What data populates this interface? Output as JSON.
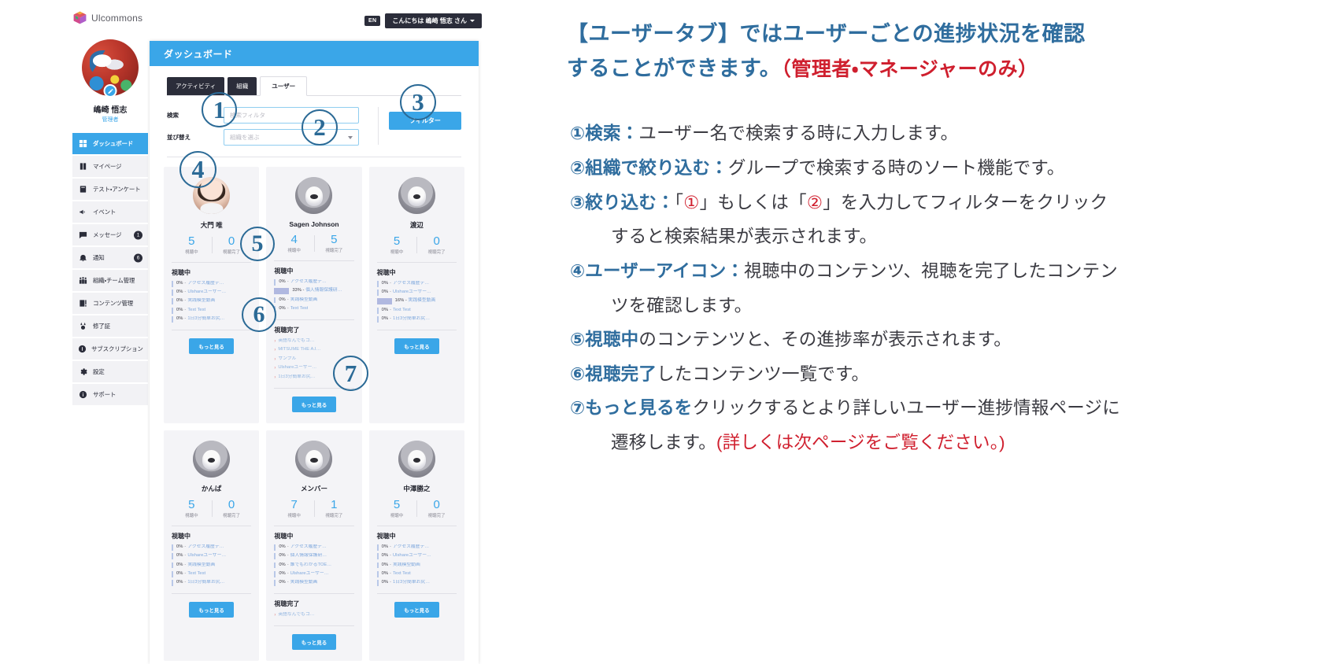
{
  "app": {
    "brand": "Ulcommons",
    "topbar": {
      "lang_button": "EN",
      "greeting_button": "こんにちは 嶋崎  悟志 さん"
    },
    "profile": {
      "name": "嶋崎  悟志",
      "role": "管理者"
    },
    "menu": [
      {
        "label": "ダッシュボード",
        "icon": "grid-icon",
        "badge": "",
        "active": true
      },
      {
        "label": "マイページ",
        "icon": "book-icon",
        "badge": "",
        "active": false
      },
      {
        "label": "テスト・アンケート",
        "icon": "clipboard-icon",
        "badge": "",
        "active": false
      },
      {
        "label": "イベント",
        "icon": "megaphone-icon",
        "badge": "",
        "active": false
      },
      {
        "label": "メッセージ",
        "icon": "chat-icon",
        "badge": "1",
        "active": false
      },
      {
        "label": "通知",
        "icon": "bell-icon",
        "badge": "6",
        "active": false
      },
      {
        "label": "組織・チーム管理",
        "icon": "people-icon",
        "badge": "",
        "active": false
      },
      {
        "label": "コンテンツ管理",
        "icon": "content-icon",
        "badge": "",
        "active": false
      },
      {
        "label": "修了証",
        "icon": "medal-icon",
        "badge": "",
        "active": false
      },
      {
        "label": "サブスクリプション",
        "icon": "coin-icon",
        "badge": "",
        "active": false
      },
      {
        "label": "設定",
        "icon": "gear-icon",
        "badge": "",
        "active": false
      },
      {
        "label": "サポート",
        "icon": "info-icon",
        "badge": "",
        "active": false
      }
    ],
    "panel": {
      "title": "ダッシュボード",
      "tabs": [
        {
          "label": "アクティビティ",
          "active": false
        },
        {
          "label": "組織",
          "active": false
        },
        {
          "label": "ユーザー",
          "active": true
        }
      ],
      "filter": {
        "search_label": "検索",
        "search_placeholder": "検索フィルタ",
        "search_value": "",
        "sort_label": "並び替え",
        "sort_placeholder": "組織を選ぶ",
        "sort_value": "",
        "filter_button": "フィルター"
      },
      "card_labels": {
        "watching_stat": "視聴中",
        "completed_stat": "視聴完了",
        "watching_section": "視聴中",
        "completed_section": "視聴完了",
        "more_button": "もっと見る"
      },
      "users": [
        {
          "name": "大門  唯",
          "avatar": "woman-photo",
          "watching_count": "5",
          "completed_count": "0",
          "watching": [
            {
              "pct": "0%",
              "title": "アクセス履歴テ…"
            },
            {
              "pct": "0%",
              "title": "Ulshareユーザー…"
            },
            {
              "pct": "0%",
              "title": "実践模型動画"
            },
            {
              "pct": "0%",
              "title": "Text Test"
            },
            {
              "pct": "0%",
              "title": "1日3分簡単お尻…"
            }
          ],
          "completed": []
        },
        {
          "name": "Sagen Johnson",
          "avatar": "dog-photo",
          "watching_count": "4",
          "completed_count": "5",
          "watching": [
            {
              "pct": "0%",
              "title": "アクセス履歴テ…"
            },
            {
              "pct": "33%",
              "title": "個人情報保護研…",
              "has_bar": true
            },
            {
              "pct": "0%",
              "title": "実践模型動画"
            },
            {
              "pct": "0%",
              "title": "Text Test"
            }
          ],
          "completed": [
            {
              "title": "英語なんでもコ…"
            },
            {
              "title": "MITSUME THE A.I…"
            },
            {
              "title": "サンプル"
            },
            {
              "title": "Ulshareユーザー…"
            },
            {
              "title": "1日3分簡単お尻…"
            }
          ]
        },
        {
          "name": "渡辺",
          "avatar": "dog-photo",
          "watching_count": "5",
          "completed_count": "0",
          "watching": [
            {
              "pct": "0%",
              "title": "アクセス履歴テ…"
            },
            {
              "pct": "0%",
              "title": "Ulshareユーザー…"
            },
            {
              "pct": "16%",
              "title": "実践模型動画",
              "has_bar": true
            },
            {
              "pct": "0%",
              "title": "Text Test"
            },
            {
              "pct": "0%",
              "title": "1日3分簡単お尻…"
            }
          ],
          "completed": []
        },
        {
          "name": "かんぱ",
          "avatar": "dog-photo",
          "watching_count": "5",
          "completed_count": "0",
          "watching": [
            {
              "pct": "0%",
              "title": "アクセス履歴テ…"
            },
            {
              "pct": "0%",
              "title": "Ulshareユーザー…"
            },
            {
              "pct": "0%",
              "title": "実践模型動画"
            },
            {
              "pct": "0%",
              "title": "Text Test"
            },
            {
              "pct": "0%",
              "title": "1日3分簡単お尻…"
            }
          ],
          "completed": []
        },
        {
          "name": "メンバー",
          "avatar": "dog-photo",
          "watching_count": "7",
          "completed_count": "1",
          "watching": [
            {
              "pct": "0%",
              "title": "アクセス履歴テ…"
            },
            {
              "pct": "0%",
              "title": "個人情報保護研…"
            },
            {
              "pct": "0%",
              "title": "誰でもわかるTOE…"
            },
            {
              "pct": "0%",
              "title": "Ulshareユーザー…"
            },
            {
              "pct": "0%",
              "title": "実践模型動画"
            }
          ],
          "completed": [
            {
              "title": "英語なんでもコ…"
            }
          ]
        },
        {
          "name": "中澤勝之",
          "avatar": "dog-photo",
          "watching_count": "5",
          "completed_count": "0",
          "watching": [
            {
              "pct": "0%",
              "title": "アクセス履歴テ…"
            },
            {
              "pct": "0%",
              "title": "Ulshareユーザー…"
            },
            {
              "pct": "0%",
              "title": "実践模型動画"
            },
            {
              "pct": "0%",
              "title": "Text Test"
            },
            {
              "pct": "0%",
              "title": "1日3分簡単お尻…"
            }
          ],
          "completed": []
        }
      ]
    },
    "callouts": [
      {
        "number": "1"
      },
      {
        "number": "2"
      },
      {
        "number": "3"
      },
      {
        "number": "4"
      },
      {
        "number": "5"
      },
      {
        "number": "6"
      },
      {
        "number": "7"
      }
    ]
  },
  "notes": {
    "heading_line1": "【ユーザータブ】ではユーザーごとの進捗状況を確認",
    "heading_line2_main": "することができます。",
    "heading_line2_red": "（管理者・マネージャーのみ）",
    "items": [
      {
        "number": "①",
        "keyword": "検索：",
        "text": "ユーザー名で検索する時に入力します。"
      },
      {
        "number": "②",
        "keyword": "組織で絞り込む：",
        "text": "グループで検索する時のソート機能です。"
      },
      {
        "number": "③",
        "keyword": "絞り込む：",
        "text_a": "「",
        "ref1": "①",
        "text_b": "」もしくは「",
        "ref2": "②",
        "text_c": "」を入力してフィルターをクリック",
        "cont": "すると検索結果が表示されます。"
      },
      {
        "number": "④",
        "keyword": "ユーザーアイコン：",
        "text": "視聴中のコンテンツ、視聴を完了したコンテン",
        "cont": "ツを確認します。"
      },
      {
        "number": "⑤",
        "keyword": "視聴中",
        "text": "のコンテンツと、その進捗率が表示されます。"
      },
      {
        "number": "⑥",
        "keyword": "視聴完了",
        "text": "したコンテンツ一覧です。"
      },
      {
        "number": "⑦",
        "keyword": "もっと見るを",
        "text": "クリックするとより詳しいユーザー進捗情報ページに",
        "cont_a": "遷移します。",
        "cont_red": "(詳しくは次ページをご覧ください。)"
      }
    ]
  }
}
